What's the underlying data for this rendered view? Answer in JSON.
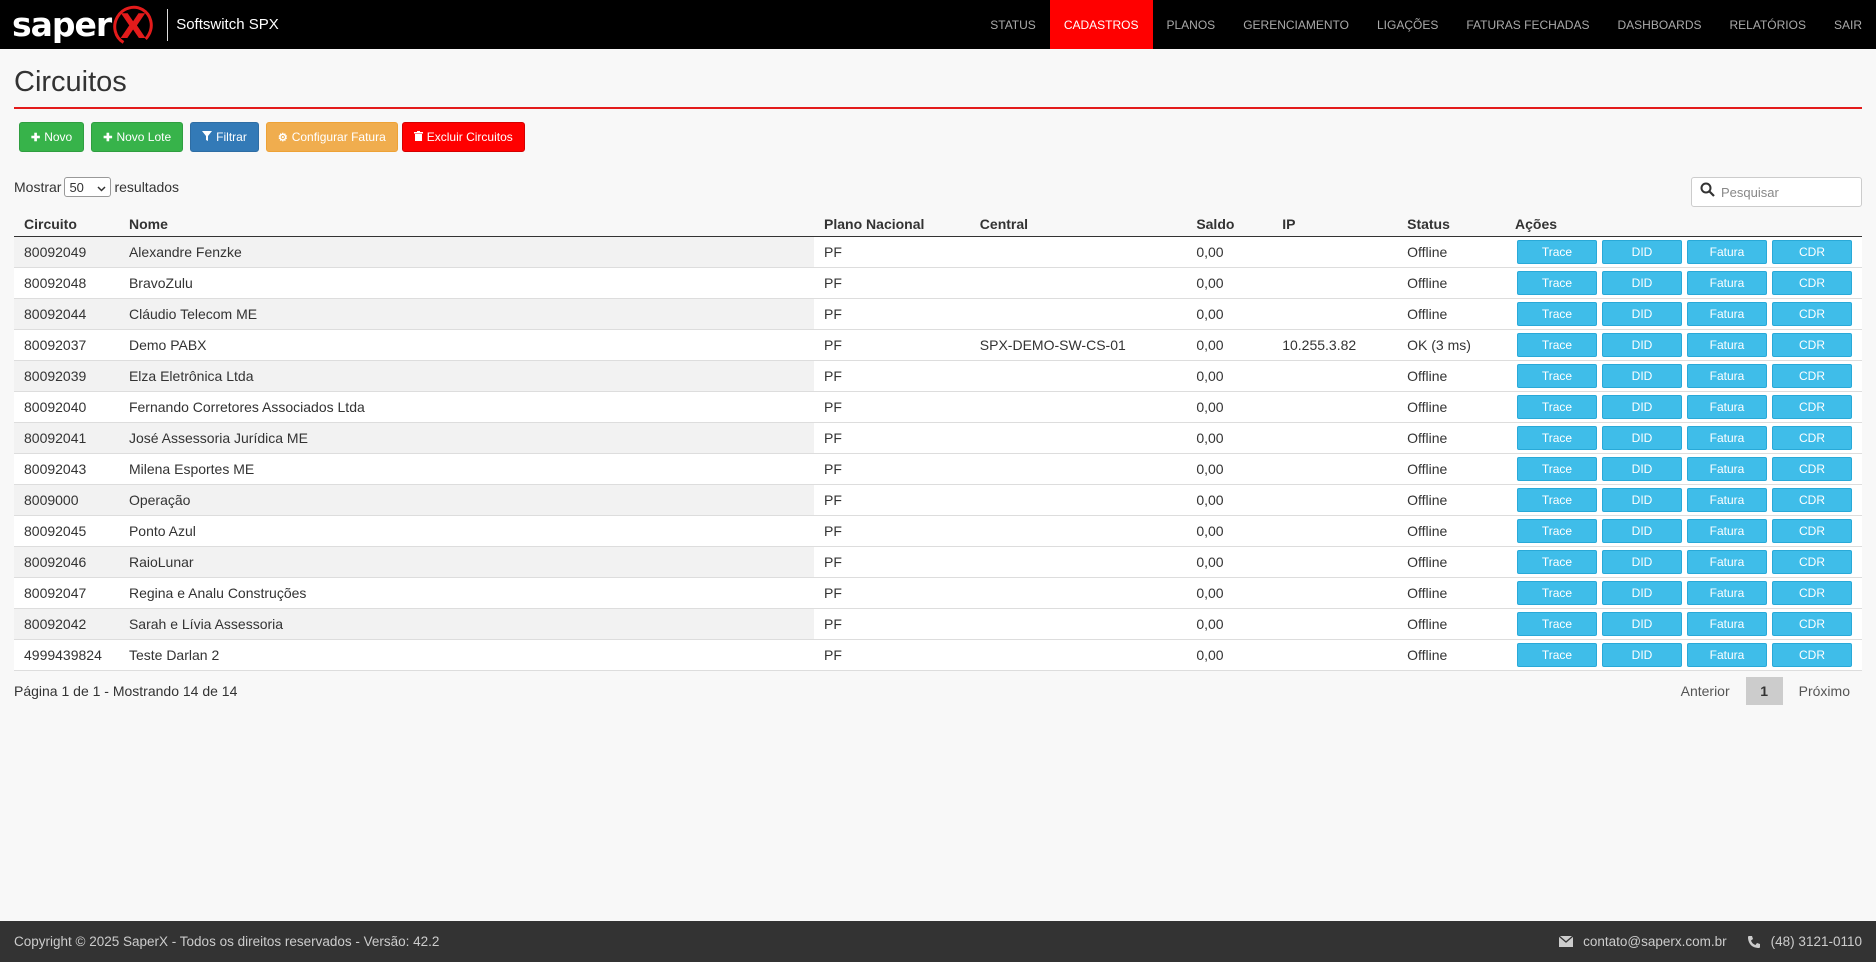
{
  "brand": {
    "logo": "saper",
    "logo_x": "X",
    "app_name": "Softswitch SPX"
  },
  "nav": [
    {
      "label": "STATUS",
      "active": false
    },
    {
      "label": "CADASTROS",
      "active": true
    },
    {
      "label": "PLANOS",
      "active": false
    },
    {
      "label": "GERENCIAMENTO",
      "active": false
    },
    {
      "label": "LIGAÇÕES",
      "active": false
    },
    {
      "label": "FATURAS FECHADAS",
      "active": false
    },
    {
      "label": "DASHBOARDS",
      "active": false
    },
    {
      "label": "RELATÓRIOS",
      "active": false
    },
    {
      "label": "SAIR",
      "active": false
    }
  ],
  "page": {
    "title": "Circuitos"
  },
  "toolbar": {
    "novo": "Novo",
    "novo_lote": "Novo Lote",
    "filtrar": "Filtrar",
    "configurar_fatura": "Configurar Fatura",
    "excluir": "Excluir Circuitos"
  },
  "list": {
    "show_label": "Mostrar",
    "page_size": "50",
    "results_label": "resultados",
    "search_placeholder": "Pesquisar"
  },
  "table": {
    "headers": [
      "Circuito",
      "Nome",
      "Plano Nacional",
      "Central",
      "Saldo",
      "IP",
      "Status",
      "Ações"
    ],
    "action_labels": [
      "Trace",
      "DID",
      "Fatura",
      "CDR"
    ],
    "rows": [
      {
        "circuito": "80092049",
        "nome": "Alexandre Fenzke",
        "plano": "PF",
        "central": "",
        "saldo": "0,00",
        "ip": "",
        "status": "Offline"
      },
      {
        "circuito": "80092048",
        "nome": "BravoZulu",
        "plano": "PF",
        "central": "",
        "saldo": "0,00",
        "ip": "",
        "status": "Offline"
      },
      {
        "circuito": "80092044",
        "nome": "Cláudio Telecom ME",
        "plano": "PF",
        "central": "",
        "saldo": "0,00",
        "ip": "",
        "status": "Offline"
      },
      {
        "circuito": "80092037",
        "nome": "Demo PABX",
        "plano": "PF",
        "central": "SPX-DEMO-SW-CS-01",
        "saldo": "0,00",
        "ip": "10.255.3.82",
        "status": "OK (3 ms)"
      },
      {
        "circuito": "80092039",
        "nome": "Elza Eletrônica Ltda",
        "plano": "PF",
        "central": "",
        "saldo": "0,00",
        "ip": "",
        "status": "Offline"
      },
      {
        "circuito": "80092040",
        "nome": "Fernando Corretores Associados Ltda",
        "plano": "PF",
        "central": "",
        "saldo": "0,00",
        "ip": "",
        "status": "Offline"
      },
      {
        "circuito": "80092041",
        "nome": "José Assessoria Jurídica ME",
        "plano": "PF",
        "central": "",
        "saldo": "0,00",
        "ip": "",
        "status": "Offline"
      },
      {
        "circuito": "80092043",
        "nome": "Milena Esportes ME",
        "plano": "PF",
        "central": "",
        "saldo": "0,00",
        "ip": "",
        "status": "Offline"
      },
      {
        "circuito": "8009000",
        "nome": "Operação",
        "plano": "PF",
        "central": "",
        "saldo": "0,00",
        "ip": "",
        "status": "Offline"
      },
      {
        "circuito": "80092045",
        "nome": "Ponto Azul",
        "plano": "PF",
        "central": "",
        "saldo": "0,00",
        "ip": "",
        "status": "Offline"
      },
      {
        "circuito": "80092046",
        "nome": "RaioLunar",
        "plano": "PF",
        "central": "",
        "saldo": "0,00",
        "ip": "",
        "status": "Offline"
      },
      {
        "circuito": "80092047",
        "nome": "Regina e Analu Construções",
        "plano": "PF",
        "central": "",
        "saldo": "0,00",
        "ip": "",
        "status": "Offline"
      },
      {
        "circuito": "80092042",
        "nome": "Sarah e Lívia Assessoria",
        "plano": "PF",
        "central": "",
        "saldo": "0,00",
        "ip": "",
        "status": "Offline"
      },
      {
        "circuito": "4999439824",
        "nome": "Teste Darlan 2",
        "plano": "PF",
        "central": "",
        "saldo": "0,00",
        "ip": "",
        "status": "Offline"
      }
    ]
  },
  "pagination": {
    "info": "Página 1 de 1 - Mostrando 14 de 14",
    "prev": "Anterior",
    "current": "1",
    "next": "Próximo"
  },
  "footer": {
    "copyright": "Copyright © 2025 SaperX - Todos os direitos reservados - Versão: 42.2",
    "email": "contato@saperx.com.br",
    "phone": "(48) 3121-0110"
  },
  "colors": {
    "accent": "#ff0000",
    "action_button": "#3fbde9",
    "green": "#37b34a",
    "blue": "#337ab7",
    "orange": "#f0ad4e"
  }
}
